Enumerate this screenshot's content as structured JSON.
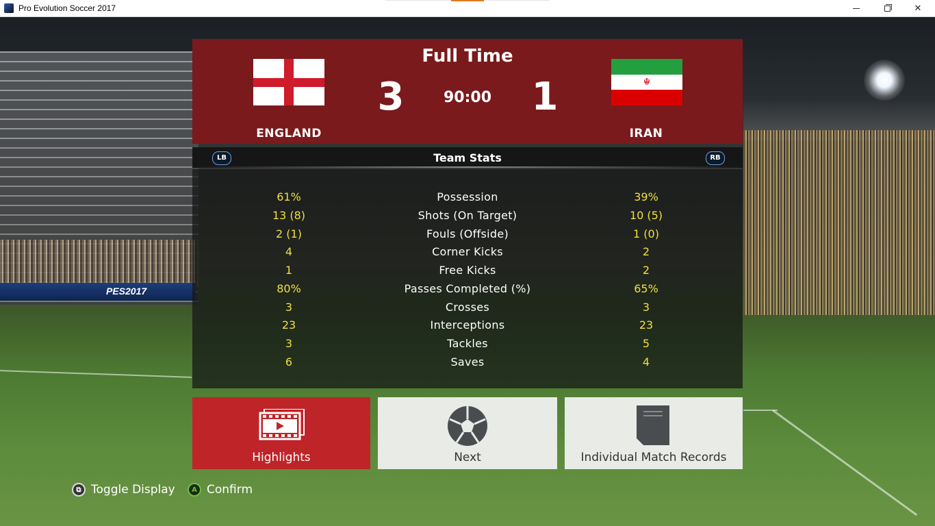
{
  "window": {
    "title": "Pro Evolution Soccer 2017",
    "minimize": "minimize",
    "maximize": "restore",
    "close": "close"
  },
  "background": {
    "adboard_text": "PES2017"
  },
  "match": {
    "status": "Full Time",
    "clock": "90:00",
    "home": {
      "name": "ENGLAND",
      "score": "3",
      "flag": "england-flag-icon"
    },
    "away": {
      "name": "IRAN",
      "score": "1",
      "flag": "iran-flag-icon"
    }
  },
  "stats_header": {
    "title": "Team Stats",
    "lb": "LB",
    "rb": "RB"
  },
  "stats": [
    {
      "label": "Possession",
      "home": "61%",
      "away": "39%"
    },
    {
      "label": "Shots (On Target)",
      "home": "13 (8)",
      "away": "10 (5)"
    },
    {
      "label": "Fouls (Offside)",
      "home": "2 (1)",
      "away": "1 (0)"
    },
    {
      "label": "Corner Kicks",
      "home": "4",
      "away": "2"
    },
    {
      "label": "Free Kicks",
      "home": "1",
      "away": "2"
    },
    {
      "label": "Passes Completed (%)",
      "home": "80%",
      "away": "65%"
    },
    {
      "label": "Crosses",
      "home": "3",
      "away": "3"
    },
    {
      "label": "Interceptions",
      "home": "23",
      "away": "23"
    },
    {
      "label": "Tackles",
      "home": "3",
      "away": "5"
    },
    {
      "label": "Saves",
      "home": "6",
      "away": "4"
    }
  ],
  "buttons": {
    "highlights": {
      "label": "Highlights",
      "icon": "film-icon"
    },
    "next": {
      "label": "Next",
      "icon": "soccer-ball-icon"
    },
    "records": {
      "label": "Individual Match Records",
      "icon": "document-icon"
    }
  },
  "hints": {
    "toggle": "Toggle Display",
    "confirm": "Confirm",
    "confirm_key": "A"
  },
  "colors": {
    "header_bg": "#7a1a1c",
    "selected_button": "#bf2428",
    "stat_value": "#f0e040"
  }
}
